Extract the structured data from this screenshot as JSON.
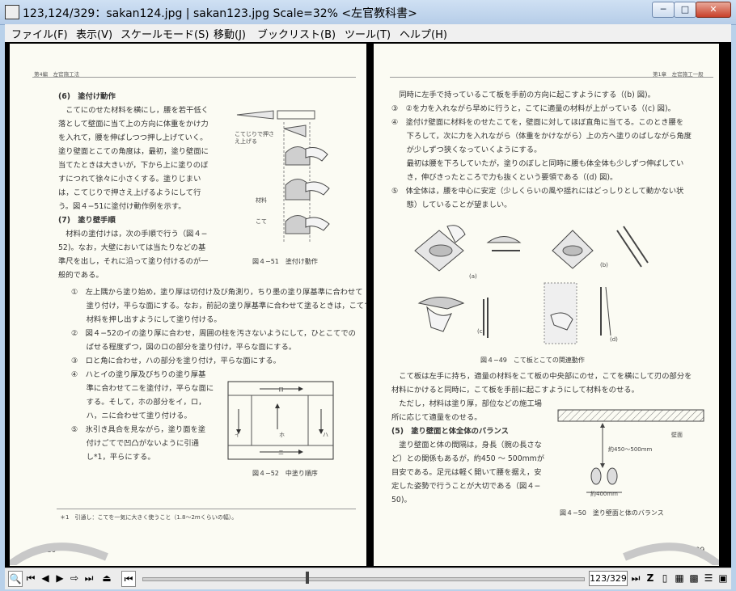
{
  "window": {
    "title": "123,124/329：sakan124.jpg | sakan123.jpg  Scale=32%   <左官教科書>"
  },
  "menu": [
    "ファイル(F)",
    "表示(V)",
    "スケールモード(S)",
    "移動(J)",
    "ブックリスト(B)",
    "ツール(T)",
    "ヘルプ(H)"
  ],
  "left": {
    "header": "第4編　左官施工法",
    "lines": [
      "(6)　塗付け動作",
      "　こてにのせた材料を横にし，腰を若干低く",
      "落として壁面に当て上の方向に体重をかけ力",
      "を入れて，腰を伸ばしつつ押し上げていく。",
      "塗り壁面とこての角度は，最初，塗り壁面に",
      "当てたときは大きいが，下から上に塗りのぼ",
      "すにつれて徐々に小さくする。塗りじまい",
      "は，こてじりで押さえ上げるようにして行",
      "う。図４−51に塗付け動作例を示す。",
      "(7)　塗り壁手順",
      "　材料の塗付けは，次の手順で行う（図４−",
      "52)。なお，大壁においては当たりなどの基",
      "準尺を出し，それに沿って塗り付けるのが一",
      "般的である。"
    ],
    "fig51_caption": "図４−51　塗付け動作",
    "fig51_labels": [
      "こてじりで押さえ上げる",
      "材料",
      "こて"
    ],
    "steps": [
      "①　左上隅から塗り始め，塗り厚は切付け及び角測り，ちり墨の塗り厚基準に合わせて",
      "　　塗り付け，平らな面にする。なお，前記の塗り厚基準に合わせて塗るときは，こてで",
      "　　材料を押し出すようにして塗り付ける。",
      "②　図４−52のイの塗り厚に合わせ，周囲の柱を汚さないようにして，ひとこてでの",
      "　　ばせる程度ずつ，図のロの部分を塗り付け，平らな面にする。",
      "③　ロと角に合わせ，ハの部分を塗り付け，平らな面にする。",
      "④　ハとイの塗り厚及びちりの塗り厚基",
      "　　準に合わせてニを塗付け，平らな面に",
      "　　する。そして，ホの部分をイ，ロ，",
      "　　ハ，ニに合わせて塗り付ける。",
      "⑤　氷引き具合を見ながら，塗り面を塗",
      "　　付けごてで凹凸がないように引通",
      "　　し*1，平らにする。"
    ],
    "fig52_labels": [
      "ロ",
      "イ",
      "ホ",
      "ハ",
      "ニ"
    ],
    "fig52_caption": "図４−52　中塗り順序",
    "footnote": "＊1　引通し：こてを一気に大きく使うこと（1.8～2mくらいの幅）。",
    "page_number": "110"
  },
  "right": {
    "header": "第1章　左官施工一般",
    "lines": [
      "　同時に左手で持っているこて板を手前の方向に起こすようにする（(b) 図)。",
      "③　②を力を入れながら早めに行うと，こてに適量の材料が上がっている（(c) 図)。",
      "④　塗付け壁面に材料をのせたこてを，壁面に対してほぼ直角に当てる。このとき腰を",
      "　　下ろして，次に力を入れながら（体重をかけながら）上の方へ塗りのばしながら角度",
      "　　が少しずつ狭くなっていくようにする。",
      "　　最初は腰を下ろしていたが，塗りのぼしと同時に腰も体全体も少しずつ伸ばしてい",
      "　　き，伸びきったところで力も抜くという要領である（(d) 図)。",
      "⑤　体全体は，腰を中心に安定（少しくらいの風や揺れにはどっしりとして動かない状",
      "　　態）していることが望ましい。"
    ],
    "fig49_labels": [
      "(a)",
      "(b)",
      "(c)",
      "(d)"
    ],
    "fig49_caption": "図４−49　こて板とこての関連動作",
    "lines2": [
      "　こて板は左手に持ち，適量の材料をこて板の中央部にのせ，こてを横にして刃の部分を",
      "材料にかけると同時に，こて板を手前に起こすようにして材料をのせる。",
      "　ただし，材料は塗り厚，部位などの施工場",
      "所に応じて適量をのせる。",
      "(5)　塗り壁面と体全体のバランス",
      "　塗り壁面と体の間隔は，身長（腕の長さな",
      "ど）との関係もあるが，約450 ～ 500mmが",
      "目安である。足元は軽く開いて腰を据え，安",
      "定した姿勢で行うことが大切である（図４−",
      "50)。"
    ],
    "fig50_labels": [
      "壁面",
      "約450〜500mm",
      "約400mm"
    ],
    "fig50_caption": "図４−50　塗り壁面と体のバランス",
    "page_number": "109"
  },
  "toolbar": {
    "page_indicator": "123/329"
  }
}
